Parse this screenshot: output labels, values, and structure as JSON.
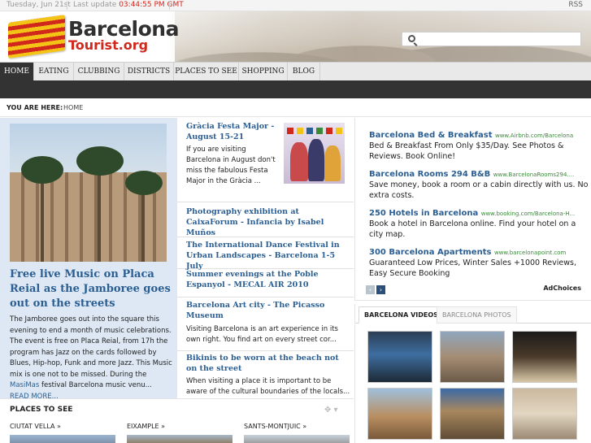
{
  "topbar": {
    "date": "Tuesday, Jun 21st",
    "last_update_label": "Last update",
    "last_update_time": "03:44:55 PM GMT",
    "rss": "RSS"
  },
  "header": {
    "logo_line1": "Barcelona",
    "logo_line2": "Tourist.org",
    "search_placeholder": ""
  },
  "nav": {
    "items": [
      "HOME",
      "EATING",
      "CLUBBING",
      "DISTRICTS",
      "PLACES TO SEE",
      "SHOPPING",
      "BLOG"
    ],
    "active": "HOME"
  },
  "breadcrumb": {
    "label": "YOU ARE HERE:",
    "current": "HOME"
  },
  "feature": {
    "title": "Free live Music on Placa Reial as the Jamboree goes out on the streets",
    "body": "The Jamboree goes out into the square this evening to end a month of music celebrations. The event is free on Placa Reial, from 17h the program has Jazz on the cards followed by Blues, Hip-hop, Funk and more Jazz. This Music mix is one not to be missed. During the",
    "body_link": "MasiMas",
    "body_end": "festival Barcelona music venu...",
    "read_more": "READ MORE..."
  },
  "stories": [
    {
      "title": "Gràcia Festa Major - August 15-21",
      "body": "If you are visiting Barcelona in August don't miss the fabulous Festa Major in the Gràcia ..."
    },
    {
      "title": "Photography exhibition at CaixaForum - Infancia by Isabel Muños",
      "body": ""
    },
    {
      "title": "The International Dance Festival in Urban Landscapes - Barcelona 1-5 July",
      "body": ""
    },
    {
      "title": "Summer evenings at the Poble Espanyol - MECAL AIR 2010",
      "body": ""
    },
    {
      "title": "Barcelona Art city - The Picasso Museum",
      "body": "Visiting Barcelona is an art experience in its own right. You find art on every street cor..."
    },
    {
      "title": "Bikinis to be worn at the beach not on the street",
      "body": "When visiting a place it is important to be aware of the cultural boundaries of the locals..."
    }
  ],
  "ads": [
    {
      "title": "Barcelona Bed & Breakfast",
      "url": "www.Airbnb.com/Barcelona",
      "desc": "Bed & Breakfast From Only $35/Day. See Photos & Reviews. Book Online!"
    },
    {
      "title": "Barcelona Rooms 294 B&B",
      "url": "www.BarcelonaRooms294....",
      "desc": "Save money, book a room or a cabin directly with us. No extra costs."
    },
    {
      "title": "250 Hotels in Barcelona",
      "url": "www.booking.com/Barcelona-H...",
      "desc": "Book a hotel in Barcelona online. Find your hotel on a city map."
    },
    {
      "title": "300 Barcelona Apartments",
      "url": "www.barcelonapoint.com",
      "desc": "Guaranteed Low Prices, Winter Sales +1000 Reviews, Easy Secure Booking"
    }
  ],
  "ad_choices": "AdChoices",
  "ad_prev": "‹",
  "ad_next": "›",
  "video_tabs": [
    "BARCELONA VIDEOS",
    "BARCELONA PHOTOS"
  ],
  "places": {
    "heading": "PLACES TO SEE",
    "columns": [
      "CIUTAT VELLA »",
      "EIXAMPLE »",
      "SANTS-MONTJUIC »"
    ]
  },
  "colors": {
    "link_blue": "#2b5f93",
    "nav_dark": "#333333",
    "accent_red": "#d0281c",
    "ad_url_green": "#3a8a3a",
    "feature_bg": "#dde8f4"
  }
}
